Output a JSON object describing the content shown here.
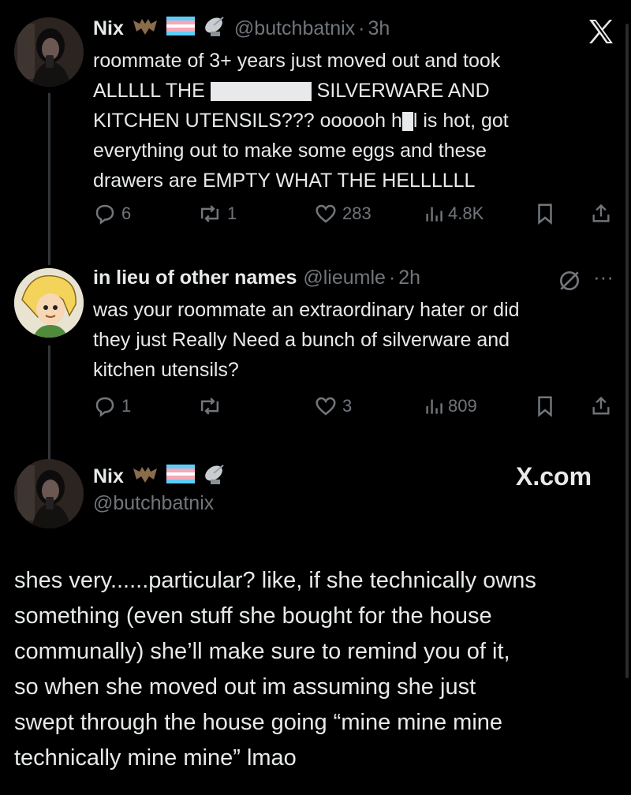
{
  "tweet1": {
    "name": "Nix",
    "handle": "@butchbatnix",
    "dot": "·",
    "time": "3h",
    "text_line1": "roommate of 3+ years just moved out and took",
    "text_line2a": "ALLLLL THE",
    "text_line2b": "SILVERWARE AND",
    "text_line3a": "KITCHEN UTENSILS??? oooooh h",
    "text_line3b": "l is hot, got",
    "text_line4": "everything out to make some eggs and these",
    "text_line5": "drawers are EMPTY WHAT THE HELLLLLL",
    "replies": "6",
    "reposts": "1",
    "likes": "283",
    "views": "4.8K"
  },
  "tweet2": {
    "name": "in lieu of other names",
    "handle": "@lieumle",
    "dot": "·",
    "time": "2h",
    "more": "···",
    "text_line1": "was your roommate an extraordinary hater or did",
    "text_line2": "they just Really Need a bunch of silverware and",
    "text_line3": "kitchen utensils?",
    "replies": "1",
    "likes": "3",
    "views": "809"
  },
  "tweet3": {
    "name": "Nix",
    "handle": "@butchbatnix",
    "site": "X.com",
    "lines": [
      "shes very......particular? like, if she technically owns",
      "something (even stuff she bought for the house",
      "communally) she’ll make sure to remind you of it,",
      "so when she moved out im assuming she just",
      "swept through the house going “mine mine mine",
      "technically mine mine” lmao"
    ]
  },
  "icons": {
    "bat": "bat-emoji",
    "trans_flag": "transgender-flag-emoji",
    "satellite": "satellite-dish-emoji"
  },
  "colors": {
    "background": "#000000",
    "text": "#e7e9ea",
    "muted": "#71767b"
  }
}
